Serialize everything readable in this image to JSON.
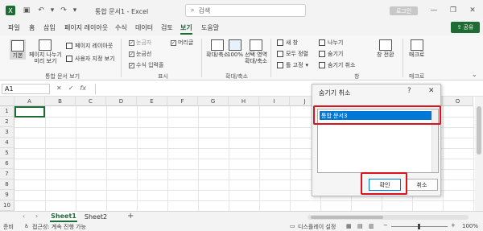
{
  "titlebar": {
    "doc_title": "통합 문서1 - Excel",
    "search_placeholder": "검색",
    "login_label": "로그인"
  },
  "menu": {
    "items": [
      "파일",
      "홈",
      "삽입",
      "페이지 레이아웃",
      "수식",
      "데이터",
      "검토",
      "보기",
      "도움말"
    ],
    "active": "보기",
    "share_label": "공유"
  },
  "ribbon": {
    "workbook_views": {
      "normal": "기본",
      "page_break_1": "페이지 나누기",
      "page_break_2": "미리 보기",
      "page_layout": "페이지 레이아웃",
      "custom_views": "사용자 지정 보기",
      "group_label": "통합 문서 보기"
    },
    "show": {
      "ruler": "눈금자",
      "formula_bar": "수식 입력줄",
      "gridlines": "눈금선",
      "headings": "머리글",
      "group_label": "표시"
    },
    "zoom": {
      "zoom": "확대/축소",
      "hundred": "100%",
      "zoom_sel_1": "선택 영역",
      "zoom_sel_2": "확대/축소",
      "group_label": "확대/축소"
    },
    "window": {
      "new_window": "새 창",
      "arrange_all": "모두 정렬",
      "freeze": "틀 고정",
      "split": "나누기",
      "hide": "숨기기",
      "unhide": "숨기기 취소",
      "switch": "창 전환",
      "group_label": "창"
    },
    "macros": {
      "label": "매크로",
      "group_label": "매크로"
    }
  },
  "formula_bar": {
    "name_box": "A1",
    "fx": "fx"
  },
  "grid": {
    "columns": [
      "A",
      "B",
      "C",
      "D",
      "E",
      "F",
      "G",
      "H",
      "I",
      "J",
      "K",
      "L",
      "M",
      "N",
      "O"
    ],
    "rows": [
      "1",
      "2",
      "3",
      "4",
      "5",
      "6",
      "7",
      "8",
      "9",
      "10"
    ]
  },
  "sheets": {
    "tabs": [
      "Sheet1",
      "Sheet2"
    ],
    "active": "Sheet1",
    "add": "+"
  },
  "status": {
    "ready": "준비",
    "accessibility": "접근성: 계속 진행 가능",
    "display_settings": "디스플레이 설정",
    "zoom_level": "100%"
  },
  "dialog": {
    "title": "숨기기 취소",
    "help": "?",
    "close": "✕",
    "items": [
      "통합 문서3"
    ],
    "ok_label": "확인",
    "cancel_label": "취소"
  },
  "colors": {
    "accent": "#1f6b36",
    "selection": "#0078d7",
    "highlight": "#d9121d"
  }
}
